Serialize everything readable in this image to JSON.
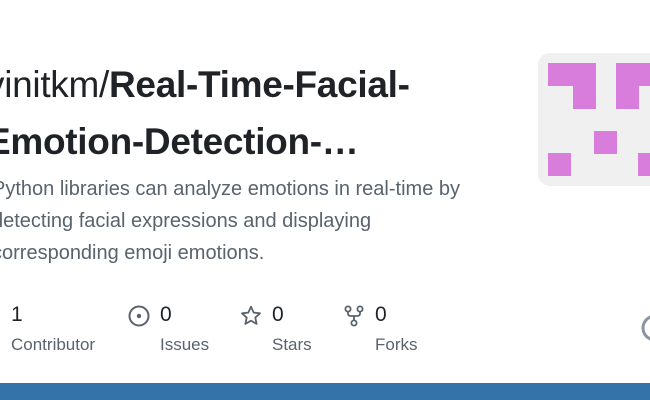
{
  "repo": {
    "owner": "vinitkm/",
    "name": "Real-Time-Facial-Emotion-Detection-…",
    "description": "Python libraries can analyze emotions in real-time by detecting facial expressions and displaying corresponding emoji emotions."
  },
  "stats": [
    {
      "icon": "people-icon",
      "count": "1",
      "label": "Contributor"
    },
    {
      "icon": "issue-icon",
      "count": "0",
      "label": "Issues"
    },
    {
      "icon": "star-icon",
      "count": "0",
      "label": "Stars"
    },
    {
      "icon": "fork-icon",
      "count": "0",
      "label": "Forks"
    }
  ],
  "colors": {
    "identicon": "#d87ddc",
    "identicon_bg": "#f0f0f0",
    "bottom_bar": "#3473aa",
    "text": "#1f2328",
    "muted": "#59636e"
  }
}
